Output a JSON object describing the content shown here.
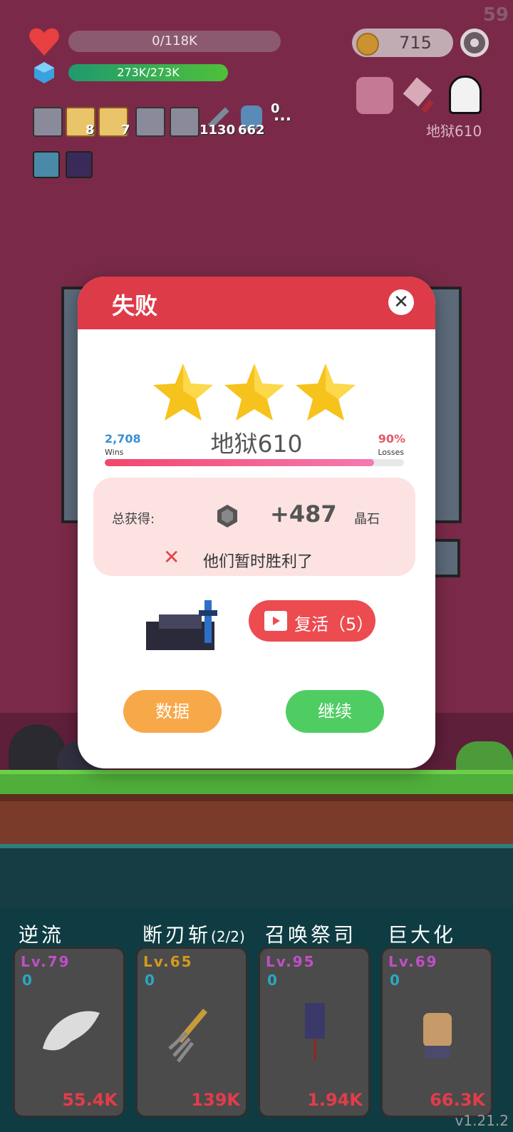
{
  "hud": {
    "hp_text": "0/118K",
    "hp_fraction": 0.0,
    "shield_text": "273K/273K",
    "shield_fraction": 1.0,
    "gold": "715",
    "settings_icon": "gear-icon",
    "level_label": "地狱610",
    "inventory_counts": [
      "8",
      "7",
      "1130",
      "662",
      "0"
    ],
    "inventory_more": "..."
  },
  "modal": {
    "title": "失败",
    "close_icon": "close-icon",
    "stars": 3,
    "wins": "2,708",
    "wins_label": "Wins",
    "losses_pct": "90%",
    "losses_label": "Losses",
    "level_name": "地狱610",
    "progress_fraction": 0.9,
    "reward": {
      "label": "总获得:",
      "value": "+487",
      "unit": "晶石",
      "icon": "gem-icon"
    },
    "fail_icon": "x-icon",
    "fail_message": "他们暂时胜利了",
    "revive_label": "复活（5）",
    "data_button": "数据",
    "continue_button": "继续"
  },
  "skills": [
    {
      "name": "逆流",
      "level": "Lv.79",
      "count": "0",
      "cost": "55.4K",
      "level_color": "#c04fc4",
      "icon": "wing-icon"
    },
    {
      "name": "断刃斩",
      "suffix": "(2/2)",
      "level": "Lv.65",
      "count": "0",
      "cost": "139K",
      "level_color": "#d39a1e",
      "icon": "pitchfork-icon"
    },
    {
      "name": "召唤祭司",
      "level": "Lv.95",
      "count": "0",
      "cost": "1.94K",
      "level_color": "#c04fc4",
      "icon": "banner-icon"
    },
    {
      "name": "巨大化",
      "level": "Lv.69",
      "count": "0",
      "cost": "66.3K",
      "level_color": "#c04fc4",
      "icon": "fist-icon"
    }
  ],
  "corner_fps": "59",
  "version": "v1.21.2"
}
